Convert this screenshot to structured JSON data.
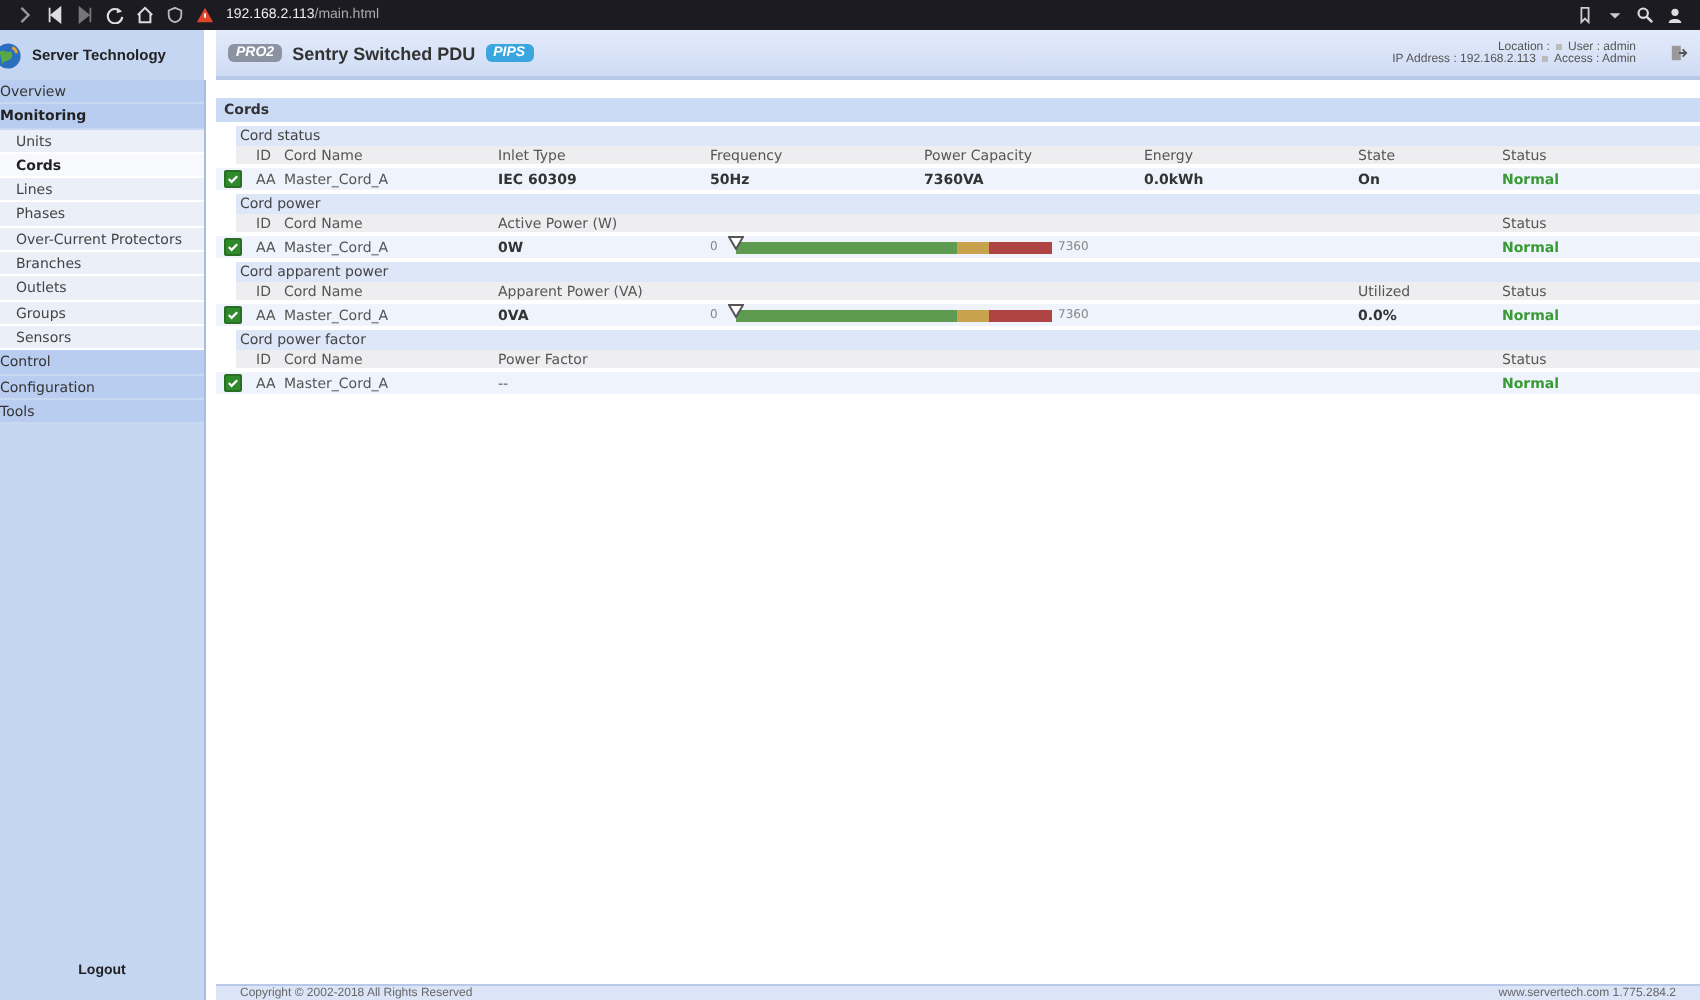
{
  "browser": {
    "url_host": "192.168.2.113",
    "url_path": "/main.html"
  },
  "header": {
    "brand": "Server Technology",
    "badge_left": "PRO2",
    "product": "Sentry Switched PDU",
    "badge_right": "PIPS",
    "location_label": "Location :",
    "user": "User : admin",
    "ip": "IP Address : 192.168.2.113",
    "access": "Access : Admin"
  },
  "sidebar": {
    "items": [
      {
        "label": "Overview",
        "selected": false
      },
      {
        "label": "Monitoring",
        "selected": false,
        "expanded": true,
        "children": [
          {
            "label": "Units",
            "selected": false
          },
          {
            "label": "Cords",
            "selected": true
          },
          {
            "label": "Lines",
            "selected": false
          },
          {
            "label": "Phases",
            "selected": false
          },
          {
            "label": "Over-Current Protectors",
            "selected": false
          },
          {
            "label": "Branches",
            "selected": false
          },
          {
            "label": "Outlets",
            "selected": false
          },
          {
            "label": "Groups",
            "selected": false
          },
          {
            "label": "Sensors",
            "selected": false
          }
        ]
      },
      {
        "label": "Control",
        "selected": false
      },
      {
        "label": "Configuration",
        "selected": false
      },
      {
        "label": "Tools",
        "selected": false
      }
    ],
    "logout": "Logout"
  },
  "panel": {
    "title": "Cords",
    "sections": [
      {
        "kind": "status",
        "title": "Cord status",
        "columns": [
          "ID",
          "Cord Name",
          "Inlet Type",
          "Frequency",
          "Power Capacity",
          "Energy",
          "State",
          "Status"
        ],
        "rows": [
          {
            "checked": true,
            "cells": [
              "AA",
              "Master_Cord_A",
              "IEC 60309",
              "50Hz",
              "7360VA",
              "0.0kWh",
              "On",
              "Normal"
            ]
          }
        ]
      },
      {
        "kind": "meter",
        "title": "Cord power",
        "headers": {
          "id": "ID",
          "name": "Cord Name",
          "value": "Active Power (W)",
          "status": "Status"
        },
        "rows": [
          {
            "checked": true,
            "id": "AA",
            "name": "Master_Cord_A",
            "value": "0W",
            "min": "0",
            "max": "7360",
            "level": 0,
            "status": "Normal"
          }
        ]
      },
      {
        "kind": "meter",
        "title": "Cord apparent power",
        "headers": {
          "id": "ID",
          "name": "Cord Name",
          "value": "Apparent Power (VA)",
          "utilized": "Utilized",
          "status": "Status"
        },
        "rows": [
          {
            "checked": true,
            "id": "AA",
            "name": "Master_Cord_A",
            "value": "0VA",
            "min": "0",
            "max": "7360",
            "level": 0,
            "utilized": "0.0%",
            "status": "Normal"
          }
        ]
      },
      {
        "kind": "plain",
        "title": "Cord power factor",
        "headers": {
          "id": "ID",
          "name": "Cord Name",
          "value": "Power Factor",
          "status": "Status"
        },
        "rows": [
          {
            "checked": true,
            "id": "AA",
            "name": "Master_Cord_A",
            "value": "--",
            "status": "Normal"
          }
        ]
      }
    ]
  },
  "footer": {
    "copyright": "Copyright © 2002-2018 All Rights Reserved",
    "contact": "www.servertech.com  1.775.284.2"
  }
}
